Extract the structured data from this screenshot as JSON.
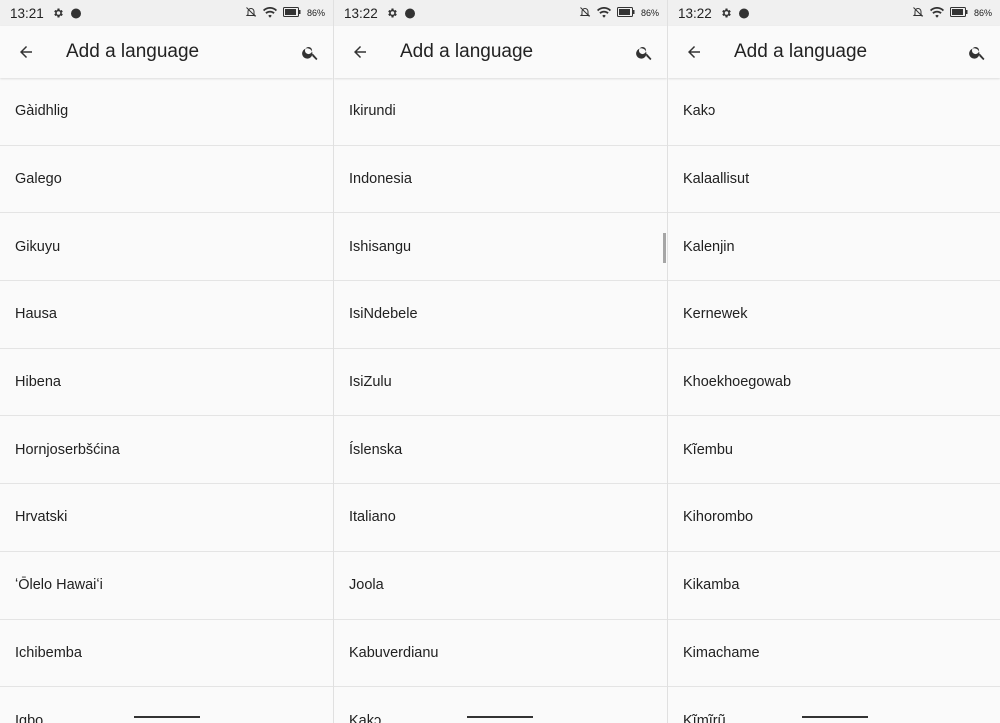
{
  "screens": [
    {
      "status": {
        "time": "13:21",
        "battery": "86%"
      },
      "appbar": {
        "title": "Add a language"
      },
      "items": [
        "Gàidhlig",
        "Galego",
        "Gikuyu",
        "Hausa",
        "Hibena",
        "Hornjoserbšćina",
        "Hrvatski",
        "ʻŌlelo Hawaiʻi",
        "Ichibemba",
        "Igbo"
      ]
    },
    {
      "status": {
        "time": "13:22",
        "battery": "86%"
      },
      "appbar": {
        "title": "Add a language"
      },
      "items": [
        "Ikirundi",
        "Indonesia",
        "Ishisangu",
        "IsiNdebele",
        "IsiZulu",
        "Íslenska",
        "Italiano",
        "Joola",
        "Kabuverdianu",
        "Kakɔ"
      ]
    },
    {
      "status": {
        "time": "13:22",
        "battery": "86%"
      },
      "appbar": {
        "title": "Add a language"
      },
      "items": [
        "Kakɔ",
        "Kalaallisut",
        "Kalenjin",
        "Kernewek",
        "Khoekhoegowab",
        "Kĩembu",
        "Kihorombo",
        "Kikamba",
        "Kimachame",
        "Kĩmĩrũ"
      ]
    }
  ],
  "icons": {
    "back": "arrow-back-icon",
    "search": "search-icon",
    "settings": "gear-icon",
    "notification": "bell-off-icon",
    "wifi": "wifi-icon",
    "battery": "battery-icon"
  }
}
